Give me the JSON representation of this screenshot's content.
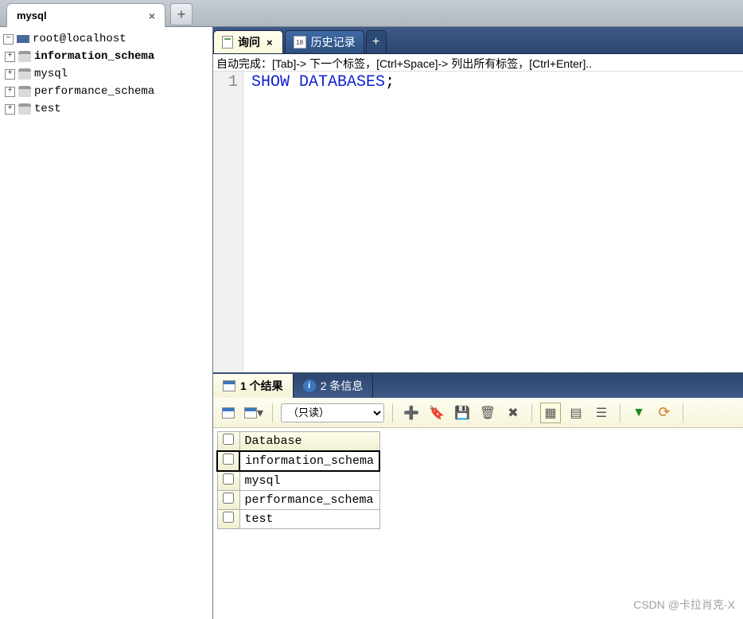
{
  "window_tab": {
    "title": "mysql"
  },
  "sidebar": {
    "server": "root@localhost",
    "databases": [
      {
        "name": "information_schema",
        "active": true
      },
      {
        "name": "mysql",
        "active": false
      },
      {
        "name": "performance_schema",
        "active": false
      },
      {
        "name": "test",
        "active": false
      }
    ]
  },
  "editor_tabs": {
    "query": "询问",
    "history": "历史记录",
    "history_day": "18"
  },
  "hint": "自动完成：[Tab]-> 下一个标签，[Ctrl+Space]-> 列出所有标签，[Ctrl+Enter]..",
  "editor": {
    "line_number": "1",
    "keyword1": "SHOW",
    "keyword2": "DATABASES",
    "semicolon": ";"
  },
  "result_tabs": {
    "result_label": "1 个结果",
    "messages_label": "2 条信息"
  },
  "toolbar": {
    "readonly": "（只读）"
  },
  "result_grid": {
    "header": "Database",
    "rows": [
      "information_schema",
      "mysql",
      "performance_schema",
      "test"
    ]
  },
  "watermark": "CSDN @卡拉肖克·X"
}
